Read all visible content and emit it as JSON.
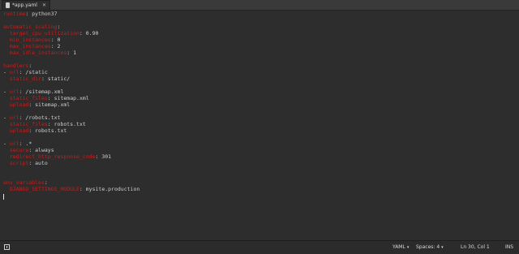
{
  "tab": {
    "title": "*app.yaml",
    "close": "✕"
  },
  "editor": {
    "lines": [
      {
        "k": "runtime",
        "p": ":",
        "v": " python37"
      },
      {
        "k": "",
        "p": "",
        "v": ""
      },
      {
        "k": "automatic_scaling",
        "p": ":",
        "v": ""
      },
      {
        "k": "  target_cpu_utilization",
        "p": ":",
        "v": " 0.90"
      },
      {
        "k": "  min_instances",
        "p": ":",
        "v": " 0"
      },
      {
        "k": "  max_instances",
        "p": ":",
        "v": " 2"
      },
      {
        "k": "  max_idle_instances",
        "p": ":",
        "v": " 1"
      },
      {
        "k": "",
        "p": "",
        "v": ""
      },
      {
        "k": "handlers",
        "p": ":",
        "v": ""
      },
      {
        "k": "- url",
        "p": ":",
        "v": " /static",
        "dash": true
      },
      {
        "k": "  static_dir",
        "p": ":",
        "v": " static/"
      },
      {
        "k": "",
        "p": "",
        "v": ""
      },
      {
        "k": "- url",
        "p": ":",
        "v": " /sitemap.xml",
        "dash": true
      },
      {
        "k": "  static_files",
        "p": ":",
        "v": " sitemap.xml"
      },
      {
        "k": "  upload",
        "p": ":",
        "v": " sitemap.xml"
      },
      {
        "k": "",
        "p": "",
        "v": ""
      },
      {
        "k": "- url",
        "p": ":",
        "v": " /robots.txt",
        "dash": true
      },
      {
        "k": "  static_files",
        "p": ":",
        "v": " robots.txt"
      },
      {
        "k": "  upload",
        "p": ":",
        "v": " robots.txt"
      },
      {
        "k": "",
        "p": "",
        "v": ""
      },
      {
        "k": "- url",
        "p": ":",
        "v": " .*",
        "dash": true
      },
      {
        "k": "  secure",
        "p": ":",
        "v": " always"
      },
      {
        "k": "  redirect_http_response_code",
        "p": ":",
        "v": " 301"
      },
      {
        "k": "  script",
        "p": ":",
        "v": " auto"
      },
      {
        "k": "",
        "p": "",
        "v": ""
      },
      {
        "k": "",
        "p": "",
        "v": ""
      },
      {
        "k": "env_variables",
        "p": ":",
        "v": ""
      },
      {
        "k": "  DJANGO_SETTINGS_MODULE",
        "p": ":",
        "v": " mysite.production"
      }
    ]
  },
  "statusbar": {
    "language": "YAML",
    "indent": "Spaces: 4",
    "position": "Ln 30, Col 1",
    "mode": "INS",
    "caret": "▾"
  }
}
